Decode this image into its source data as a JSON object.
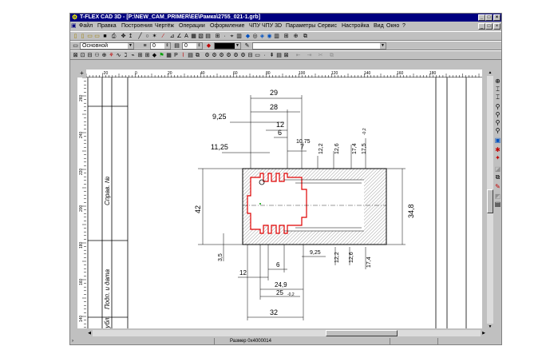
{
  "window": {
    "title": "T-FLEX CAD 3D - [P:\\NEW_CAM_PRIMER\\EE\\Рамка\\2755_021-1.grb]"
  },
  "menu": [
    "Файл",
    "Правка",
    "Построения",
    "Чертёж",
    "Операции",
    "Оформление",
    "ЧПУ",
    "ЧПУ 3D",
    "Параметры",
    "Сервис",
    "Настройка",
    "Вид",
    "Окно",
    "?"
  ],
  "toolbar2": {
    "layer": "Основной",
    "width_value": "0",
    "level_value": "0"
  },
  "ruler": {
    "top": [
      "-20",
      "0",
      "20",
      "40",
      "60",
      "80",
      "100",
      "120",
      "140",
      "160",
      "180"
    ],
    "left": [
      "260",
      "240",
      "220",
      "200",
      "180",
      "160",
      "140"
    ]
  },
  "stamp": {
    "label_top": "Справ. №",
    "label_bottom": "Подп. и дата",
    "label_bottom2": "дубл."
  },
  "dims": {
    "d29": "29",
    "d28": "28",
    "d925a": "9,25",
    "d12a": "12",
    "d6a": "6",
    "d1075": "10,75",
    "d7": "7",
    "d1125": "11,25",
    "d122a": "12,2",
    "d126a": "12,6",
    "d174a": "17,4",
    "d175a": "17,5",
    "d175a_tol": "-0,2",
    "d42": "42",
    "d348": "34,8",
    "d35": "3,5",
    "d925b": "9,25",
    "d122b": "12,2",
    "d126b": "12,6",
    "d174b": "17,4",
    "d6b": "6",
    "d12b": "12",
    "d249": "24,9",
    "d25": "25",
    "d25_tol": "-0,2",
    "d32": "32"
  },
  "status": {
    "text": "Размер 0x4000014"
  }
}
